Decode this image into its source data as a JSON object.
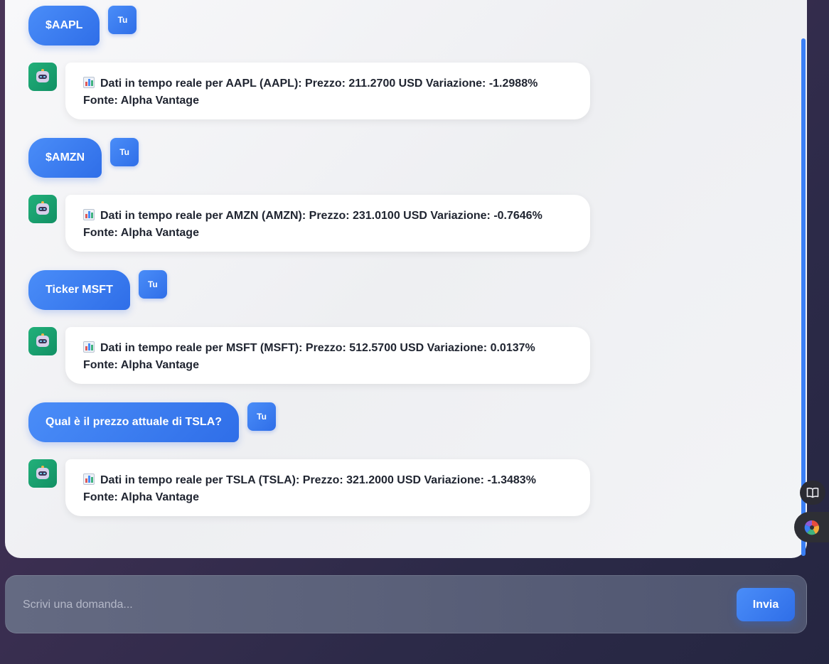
{
  "conversation": [
    {
      "role": "user",
      "text": "$AAPL",
      "badge": "Tu"
    },
    {
      "role": "bot",
      "text": "Dati in tempo reale per AAPL (AAPL): Prezzo: 211.2700 USD Variazione: -1.2988% Fonte: Alpha Vantage"
    },
    {
      "role": "user",
      "text": "$AMZN",
      "badge": "Tu"
    },
    {
      "role": "bot",
      "text": "Dati in tempo reale per AMZN (AMZN): Prezzo: 231.0100 USD Variazione: -0.7646% Fonte: Alpha Vantage"
    },
    {
      "role": "user",
      "text": "Ticker MSFT",
      "badge": "Tu"
    },
    {
      "role": "bot",
      "text": "Dati in tempo reale per MSFT (MSFT): Prezzo: 512.5700 USD Variazione: 0.0137% Fonte: Alpha Vantage"
    },
    {
      "role": "user",
      "text": "Qual è il prezzo attuale di TSLA?",
      "badge": "Tu"
    },
    {
      "role": "bot",
      "text": "Dati in tempo reale per TSLA (TSLA): Prezzo: 321.2000 USD Variazione: -1.3483% Fonte: Alpha Vantage"
    }
  ],
  "composer": {
    "placeholder": "Scrivi una domanda...",
    "value": "",
    "send_label": "Invia"
  },
  "icons": {
    "bot_avatar": "robot-icon",
    "message_prefix": "bar-chart-icon",
    "side_button_1": "book-icon",
    "side_button_2": "color-wheel-icon"
  },
  "colors": {
    "accent": "#2f6ee8",
    "bot_avatar": "#129064",
    "page_background": "#2c2a48",
    "chat_panel": "#f3f4f6"
  }
}
